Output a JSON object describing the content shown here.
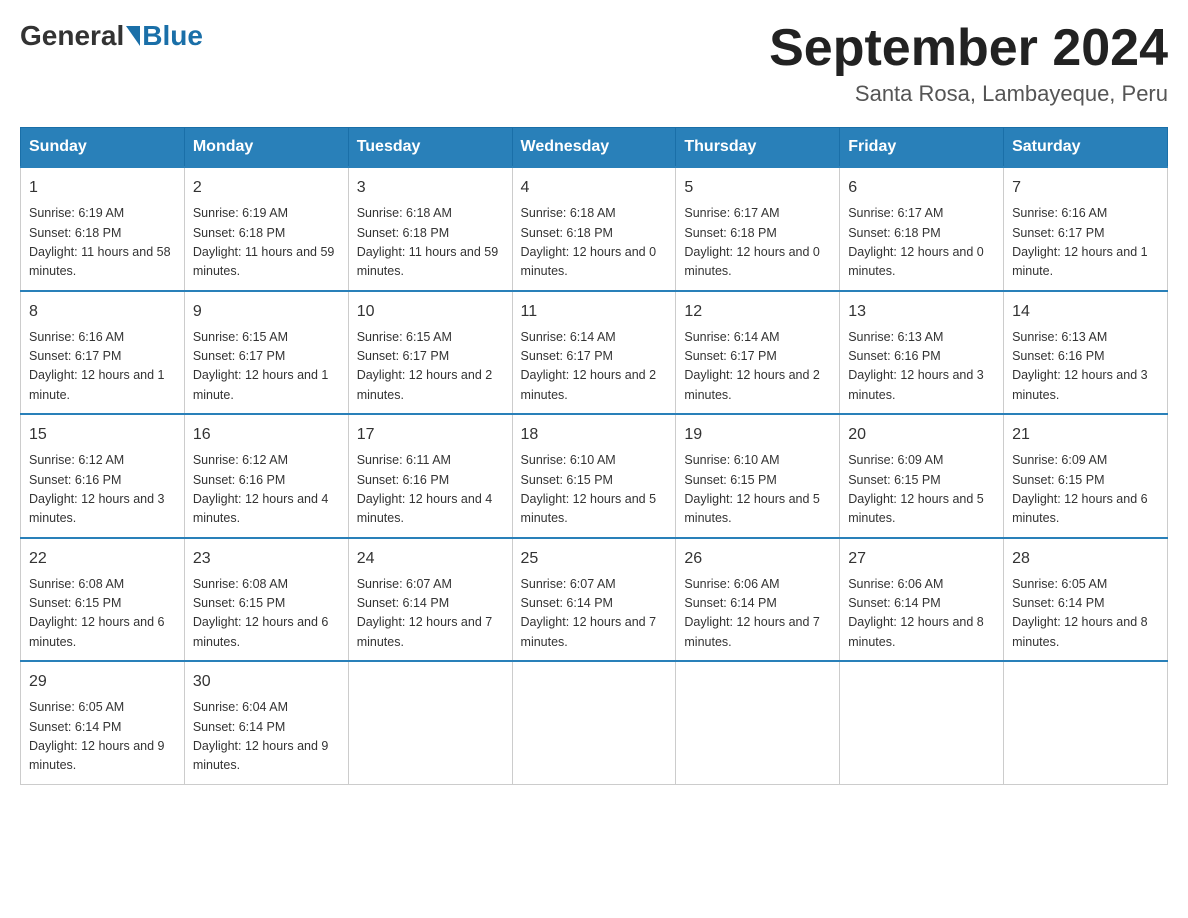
{
  "header": {
    "logo_general": "General",
    "logo_blue": "Blue",
    "month_title": "September 2024",
    "subtitle": "Santa Rosa, Lambayeque, Peru"
  },
  "days_of_week": [
    "Sunday",
    "Monday",
    "Tuesday",
    "Wednesday",
    "Thursday",
    "Friday",
    "Saturday"
  ],
  "weeks": [
    [
      {
        "day": "1",
        "sunrise": "6:19 AM",
        "sunset": "6:18 PM",
        "daylight": "11 hours and 58 minutes."
      },
      {
        "day": "2",
        "sunrise": "6:19 AM",
        "sunset": "6:18 PM",
        "daylight": "11 hours and 59 minutes."
      },
      {
        "day": "3",
        "sunrise": "6:18 AM",
        "sunset": "6:18 PM",
        "daylight": "11 hours and 59 minutes."
      },
      {
        "day": "4",
        "sunrise": "6:18 AM",
        "sunset": "6:18 PM",
        "daylight": "12 hours and 0 minutes."
      },
      {
        "day": "5",
        "sunrise": "6:17 AM",
        "sunset": "6:18 PM",
        "daylight": "12 hours and 0 minutes."
      },
      {
        "day": "6",
        "sunrise": "6:17 AM",
        "sunset": "6:18 PM",
        "daylight": "12 hours and 0 minutes."
      },
      {
        "day": "7",
        "sunrise": "6:16 AM",
        "sunset": "6:17 PM",
        "daylight": "12 hours and 1 minute."
      }
    ],
    [
      {
        "day": "8",
        "sunrise": "6:16 AM",
        "sunset": "6:17 PM",
        "daylight": "12 hours and 1 minute."
      },
      {
        "day": "9",
        "sunrise": "6:15 AM",
        "sunset": "6:17 PM",
        "daylight": "12 hours and 1 minute."
      },
      {
        "day": "10",
        "sunrise": "6:15 AM",
        "sunset": "6:17 PM",
        "daylight": "12 hours and 2 minutes."
      },
      {
        "day": "11",
        "sunrise": "6:14 AM",
        "sunset": "6:17 PM",
        "daylight": "12 hours and 2 minutes."
      },
      {
        "day": "12",
        "sunrise": "6:14 AM",
        "sunset": "6:17 PM",
        "daylight": "12 hours and 2 minutes."
      },
      {
        "day": "13",
        "sunrise": "6:13 AM",
        "sunset": "6:16 PM",
        "daylight": "12 hours and 3 minutes."
      },
      {
        "day": "14",
        "sunrise": "6:13 AM",
        "sunset": "6:16 PM",
        "daylight": "12 hours and 3 minutes."
      }
    ],
    [
      {
        "day": "15",
        "sunrise": "6:12 AM",
        "sunset": "6:16 PM",
        "daylight": "12 hours and 3 minutes."
      },
      {
        "day": "16",
        "sunrise": "6:12 AM",
        "sunset": "6:16 PM",
        "daylight": "12 hours and 4 minutes."
      },
      {
        "day": "17",
        "sunrise": "6:11 AM",
        "sunset": "6:16 PM",
        "daylight": "12 hours and 4 minutes."
      },
      {
        "day": "18",
        "sunrise": "6:10 AM",
        "sunset": "6:15 PM",
        "daylight": "12 hours and 5 minutes."
      },
      {
        "day": "19",
        "sunrise": "6:10 AM",
        "sunset": "6:15 PM",
        "daylight": "12 hours and 5 minutes."
      },
      {
        "day": "20",
        "sunrise": "6:09 AM",
        "sunset": "6:15 PM",
        "daylight": "12 hours and 5 minutes."
      },
      {
        "day": "21",
        "sunrise": "6:09 AM",
        "sunset": "6:15 PM",
        "daylight": "12 hours and 6 minutes."
      }
    ],
    [
      {
        "day": "22",
        "sunrise": "6:08 AM",
        "sunset": "6:15 PM",
        "daylight": "12 hours and 6 minutes."
      },
      {
        "day": "23",
        "sunrise": "6:08 AM",
        "sunset": "6:15 PM",
        "daylight": "12 hours and 6 minutes."
      },
      {
        "day": "24",
        "sunrise": "6:07 AM",
        "sunset": "6:14 PM",
        "daylight": "12 hours and 7 minutes."
      },
      {
        "day": "25",
        "sunrise": "6:07 AM",
        "sunset": "6:14 PM",
        "daylight": "12 hours and 7 minutes."
      },
      {
        "day": "26",
        "sunrise": "6:06 AM",
        "sunset": "6:14 PM",
        "daylight": "12 hours and 7 minutes."
      },
      {
        "day": "27",
        "sunrise": "6:06 AM",
        "sunset": "6:14 PM",
        "daylight": "12 hours and 8 minutes."
      },
      {
        "day": "28",
        "sunrise": "6:05 AM",
        "sunset": "6:14 PM",
        "daylight": "12 hours and 8 minutes."
      }
    ],
    [
      {
        "day": "29",
        "sunrise": "6:05 AM",
        "sunset": "6:14 PM",
        "daylight": "12 hours and 9 minutes."
      },
      {
        "day": "30",
        "sunrise": "6:04 AM",
        "sunset": "6:14 PM",
        "daylight": "12 hours and 9 minutes."
      },
      null,
      null,
      null,
      null,
      null
    ]
  ],
  "labels": {
    "sunrise": "Sunrise:",
    "sunset": "Sunset:",
    "daylight": "Daylight:"
  }
}
